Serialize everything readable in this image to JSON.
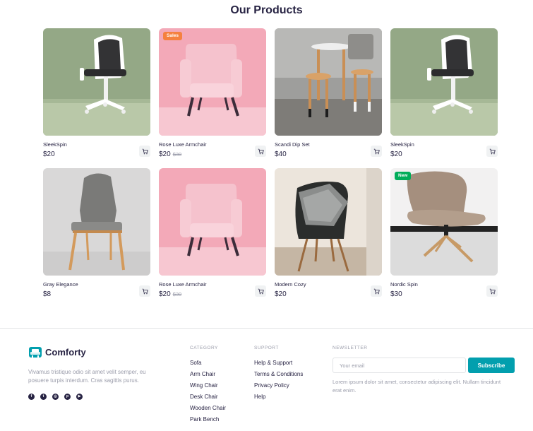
{
  "products_section": {
    "title": "Our Products"
  },
  "products": [
    {
      "name": "SleekSpin",
      "price": "$20",
      "old_price": "",
      "badge": "",
      "image": "white-office-chair-green-bg"
    },
    {
      "name": "Rose Luxe Armchair",
      "price": "$20",
      "old_price": "$30",
      "badge": "Sales",
      "image": "pink-armchair"
    },
    {
      "name": "Scandi Dip Set",
      "price": "$40",
      "old_price": "",
      "badge": "",
      "image": "wooden-stools"
    },
    {
      "name": "SleekSpin",
      "price": "$20",
      "old_price": "",
      "badge": "",
      "image": "white-office-chair-green-bg"
    },
    {
      "name": "Gray Elegance",
      "price": "$8",
      "old_price": "",
      "badge": "",
      "image": "gray-dining-chair"
    },
    {
      "name": "Rose Luxe Armchair",
      "price": "$20",
      "old_price": "$30",
      "badge": "",
      "image": "pink-armchair"
    },
    {
      "name": "Modern Cozy",
      "price": "$20",
      "old_price": "",
      "badge": "",
      "image": "black-shell-chair"
    },
    {
      "name": "Nordic Spin",
      "price": "$30",
      "old_price": "",
      "badge": "New",
      "image": "beige-swivel-chair"
    }
  ],
  "footer": {
    "brand": {
      "name": "Comforty",
      "logo_icon": "sofa-icon",
      "description": "Vivamus tristique odio sit amet velit semper, eu posuere turpis interdum. Cras sagittis purus."
    },
    "socials": [
      "facebook-icon",
      "twitter-icon",
      "instagram-icon",
      "pinterest-icon",
      "youtube-icon"
    ],
    "category": {
      "title": "CATEGORY",
      "links": [
        "Sofa",
        "Arm Chair",
        "Wing Chair",
        "Desk Chair",
        "Wooden Chair",
        "Park Bench"
      ]
    },
    "support": {
      "title": "SUPPORT",
      "links": [
        "Help & Support",
        "Terms & Conditions",
        "Privacy Policy",
        "Help"
      ]
    },
    "newsletter": {
      "title": "NEWSLETTER",
      "placeholder": "Your email",
      "button": "Subscribe",
      "description": "Lorem ipsum dolor sit amet, consectetur adipiscing elit. Nullam tincidunt erat enim."
    }
  },
  "colors": {
    "accent": "#029fae",
    "text": "#272343",
    "muted": "#9a9caa",
    "sales": "#f5813f",
    "new": "#01ad5a"
  }
}
